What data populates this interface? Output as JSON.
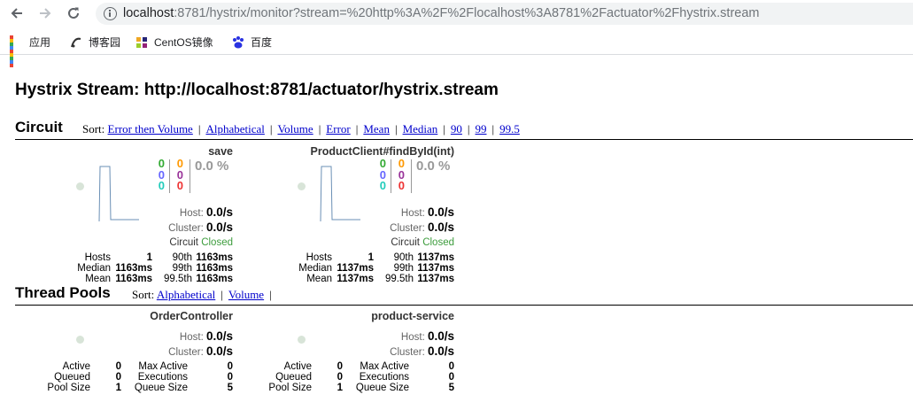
{
  "browser": {
    "url_host": "localhost",
    "url_rest": ":8781/hystrix/monitor?stream=%20http%3A%2F%2Flocalhost%3A8781%2Factuator%2Fhystrix.stream",
    "bookmarks": [
      {
        "label": "应用",
        "icon": "apps-icon"
      },
      {
        "label": "博客园",
        "icon": "cnblogs-icon"
      },
      {
        "label": "CentOS镜像",
        "icon": "centos-icon"
      },
      {
        "label": "百度",
        "icon": "baidu-icon"
      }
    ]
  },
  "page": {
    "title": "Hystrix Stream: http://localhost:8781/actuator/hystrix.stream"
  },
  "circuit": {
    "title": "Circuit",
    "sort_label": "Sort:",
    "sort_options": [
      "Error then Volume",
      "Alphabetical",
      "Volume",
      "Error",
      "Mean",
      "Median",
      "90",
      "99",
      "99.5"
    ],
    "monitors": [
      {
        "name": "save",
        "counts_left": [
          "0",
          "0",
          "0"
        ],
        "counts_right": [
          "0",
          "0",
          "0"
        ],
        "error_pct": "0.0 %",
        "host_label": "Host:",
        "host_rate": "0.0/s",
        "cluster_label": "Cluster:",
        "cluster_rate": "0.0/s",
        "circuit_label": "Circuit",
        "circuit_status": "Closed",
        "stats": {
          "hosts_label": "Hosts",
          "hosts": "1",
          "median_label": "Median",
          "median": "1163ms",
          "mean_label": "Mean",
          "mean": "1163ms",
          "p90_label": "90th",
          "p90": "1163ms",
          "p99_label": "99th",
          "p99": "1163ms",
          "p995_label": "99.5th",
          "p995": "1163ms"
        }
      },
      {
        "name": "ProductClient#findById(int)",
        "counts_left": [
          "0",
          "0",
          "0"
        ],
        "counts_right": [
          "0",
          "0",
          "0"
        ],
        "error_pct": "0.0 %",
        "host_label": "Host:",
        "host_rate": "0.0/s",
        "cluster_label": "Cluster:",
        "cluster_rate": "0.0/s",
        "circuit_label": "Circuit",
        "circuit_status": "Closed",
        "stats": {
          "hosts_label": "Hosts",
          "hosts": "1",
          "median_label": "Median",
          "median": "1137ms",
          "mean_label": "Mean",
          "mean": "1137ms",
          "p90_label": "90th",
          "p90": "1137ms",
          "p99_label": "99th",
          "p99": "1137ms",
          "p995_label": "99.5th",
          "p995": "1137ms"
        }
      }
    ]
  },
  "thread_pools": {
    "title": "Thread Pools",
    "sort_label": "Sort:",
    "sort_options": [
      "Alphabetical",
      "Volume"
    ],
    "pools": [
      {
        "name": "OrderController",
        "host_label": "Host:",
        "host_rate": "0.0/s",
        "cluster_label": "Cluster:",
        "cluster_rate": "0.0/s",
        "active_label": "Active",
        "active": "0",
        "queued_label": "Queued",
        "queued": "0",
        "pool_size_label": "Pool Size",
        "pool_size": "1",
        "max_active_label": "Max Active",
        "max_active": "0",
        "executions_label": "Executions",
        "executions": "0",
        "queue_size_label": "Queue Size",
        "queue_size": "5"
      },
      {
        "name": "product-service",
        "host_label": "Host:",
        "host_rate": "0.0/s",
        "cluster_label": "Cluster:",
        "cluster_rate": "0.0/s",
        "active_label": "Active",
        "active": "0",
        "queued_label": "Queued",
        "queued": "0",
        "pool_size_label": "Pool Size",
        "pool_size": "1",
        "max_active_label": "Max Active",
        "max_active": "0",
        "executions_label": "Executions",
        "executions": "0",
        "queue_size_label": "Queue Size",
        "queue_size": "5"
      }
    ]
  }
}
